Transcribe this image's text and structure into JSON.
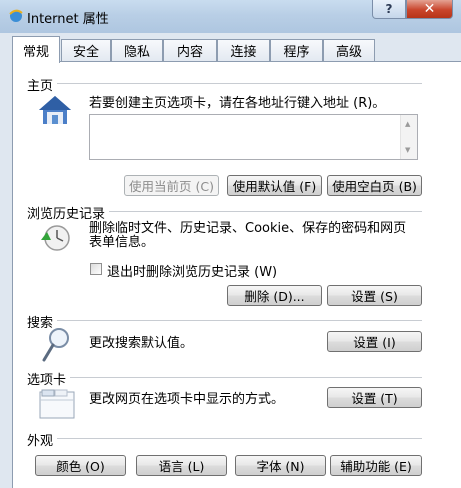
{
  "window": {
    "title": "Internet 属性",
    "help_label": "?",
    "close_label": "✕"
  },
  "tabs": [
    {
      "label": "常规",
      "active": true
    },
    {
      "label": "安全"
    },
    {
      "label": "隐私"
    },
    {
      "label": "内容"
    },
    {
      "label": "连接"
    },
    {
      "label": "程序"
    },
    {
      "label": "高级"
    }
  ],
  "home": {
    "heading": "主页",
    "description": "若要创建主页选项卡，请在各地址行键入地址 (R)。",
    "address_value": "",
    "icon": "house-icon",
    "buttons": {
      "use_current": "使用当前页 (C)",
      "use_default": "使用默认值 (F)",
      "use_blank": "使用空白页 (B)"
    }
  },
  "history": {
    "heading": "浏览历史记录",
    "description": "删除临时文件、历史记录、Cookie、保存的密码和网页表单信息。",
    "checkbox_label": "退出时删除浏览历史记录 (W)",
    "checkbox_checked": false,
    "icon": "clock-refresh-icon",
    "buttons": {
      "delete": "删除 (D)...",
      "settings": "设置 (S)"
    }
  },
  "search": {
    "heading": "搜索",
    "description": "更改搜索默认值。",
    "icon": "magnifier-icon",
    "settings_label": "设置 (I)"
  },
  "tabs_group": {
    "heading": "选项卡",
    "description": "更改网页在选项卡中显示的方式。",
    "icon": "tabbed-window-icon",
    "settings_label": "设置 (T)"
  },
  "appearance": {
    "heading": "外观",
    "buttons": {
      "colors": "颜色 (O)",
      "languages": "语言 (L)",
      "fonts": "字体 (N)",
      "accessibility": "辅助功能 (E)"
    }
  }
}
